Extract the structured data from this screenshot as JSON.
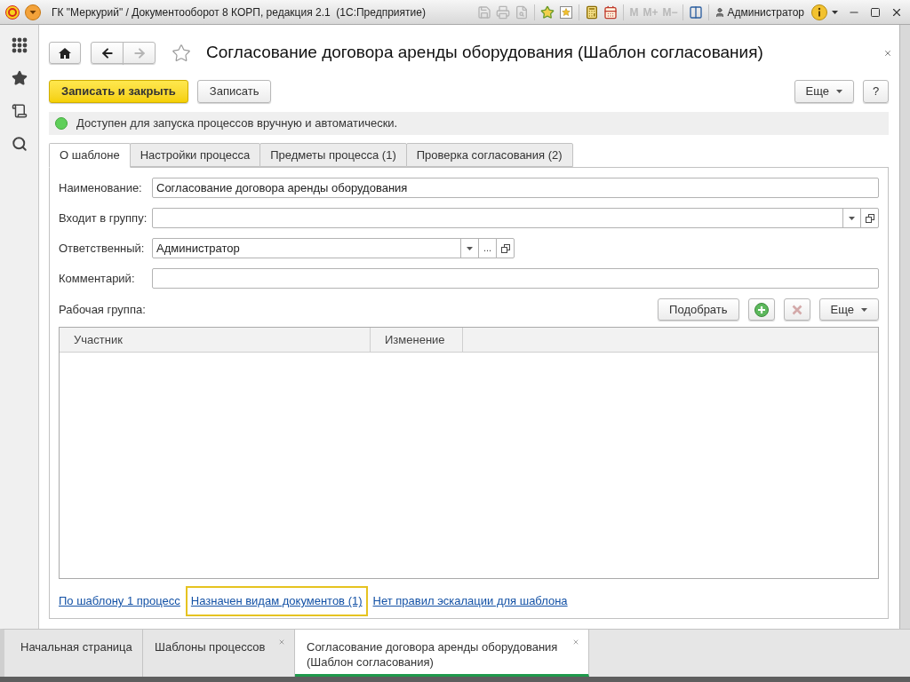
{
  "title_bar": {
    "title": "ГК \"Меркурий\" / Документооборот 8 КОРП, редакция 2.1  (1С:Предприятие)",
    "memory_buttons": [
      {
        "label": "M",
        "disabled": true
      },
      {
        "label": "M+",
        "disabled": true
      },
      {
        "label": "M−",
        "disabled": true
      }
    ],
    "user": "Администратор"
  },
  "form": {
    "title": "Согласование договора аренды оборудования (Шаблон согласования)",
    "favorite": false,
    "commands": [
      {
        "label": "Записать и закрыть",
        "kind": "primary"
      },
      {
        "label": "Записать",
        "kind": "default"
      }
    ],
    "more_button": "Еще",
    "help_button": "?",
    "status": {
      "text": "Доступен для запуска процессов вручную и автоматически.",
      "on": true
    },
    "tabs": [
      {
        "label": "О шаблоне",
        "selected": true
      },
      {
        "label": "Настройки процесса",
        "selected": false
      },
      {
        "label": "Предметы процесса (1)",
        "selected": false
      },
      {
        "label": "Проверка согласования (2)",
        "selected": false
      }
    ],
    "fields": [
      {
        "label": "Наименование:",
        "value": "Согласование договора аренды оборудования",
        "kind": "text"
      },
      {
        "label": "Входит в группу:",
        "kind": "group"
      },
      {
        "label": "Ответственный:",
        "value": "Администратор",
        "kind": "reference",
        "choose_button": "..."
      },
      {
        "label": "Комментарий:",
        "kind": "text"
      }
    ],
    "work_group": {
      "label": "Рабочая группа:",
      "pick_button": "Подобрать",
      "add_disabled": false,
      "delete_disabled": true,
      "more_button": "Еще",
      "columns": [
        "Участник",
        "Изменение"
      ]
    },
    "links": [
      {
        "label": "По шаблону 1 процесс",
        "highlighted": false
      },
      {
        "label": "Назначен видам документов (1)",
        "highlighted": true
      },
      {
        "label": "Нет правил эскалации для шаблона",
        "highlighted": false
      }
    ]
  },
  "open_windows": [
    {
      "label": "Начальная страница",
      "selected": false,
      "closable": false
    },
    {
      "label": "Шаблоны процессов",
      "selected": false,
      "closable": true
    },
    {
      "label": "Согласование договора аренды оборудования (Шаблон согласования)",
      "selected": true,
      "closable": true
    }
  ]
}
